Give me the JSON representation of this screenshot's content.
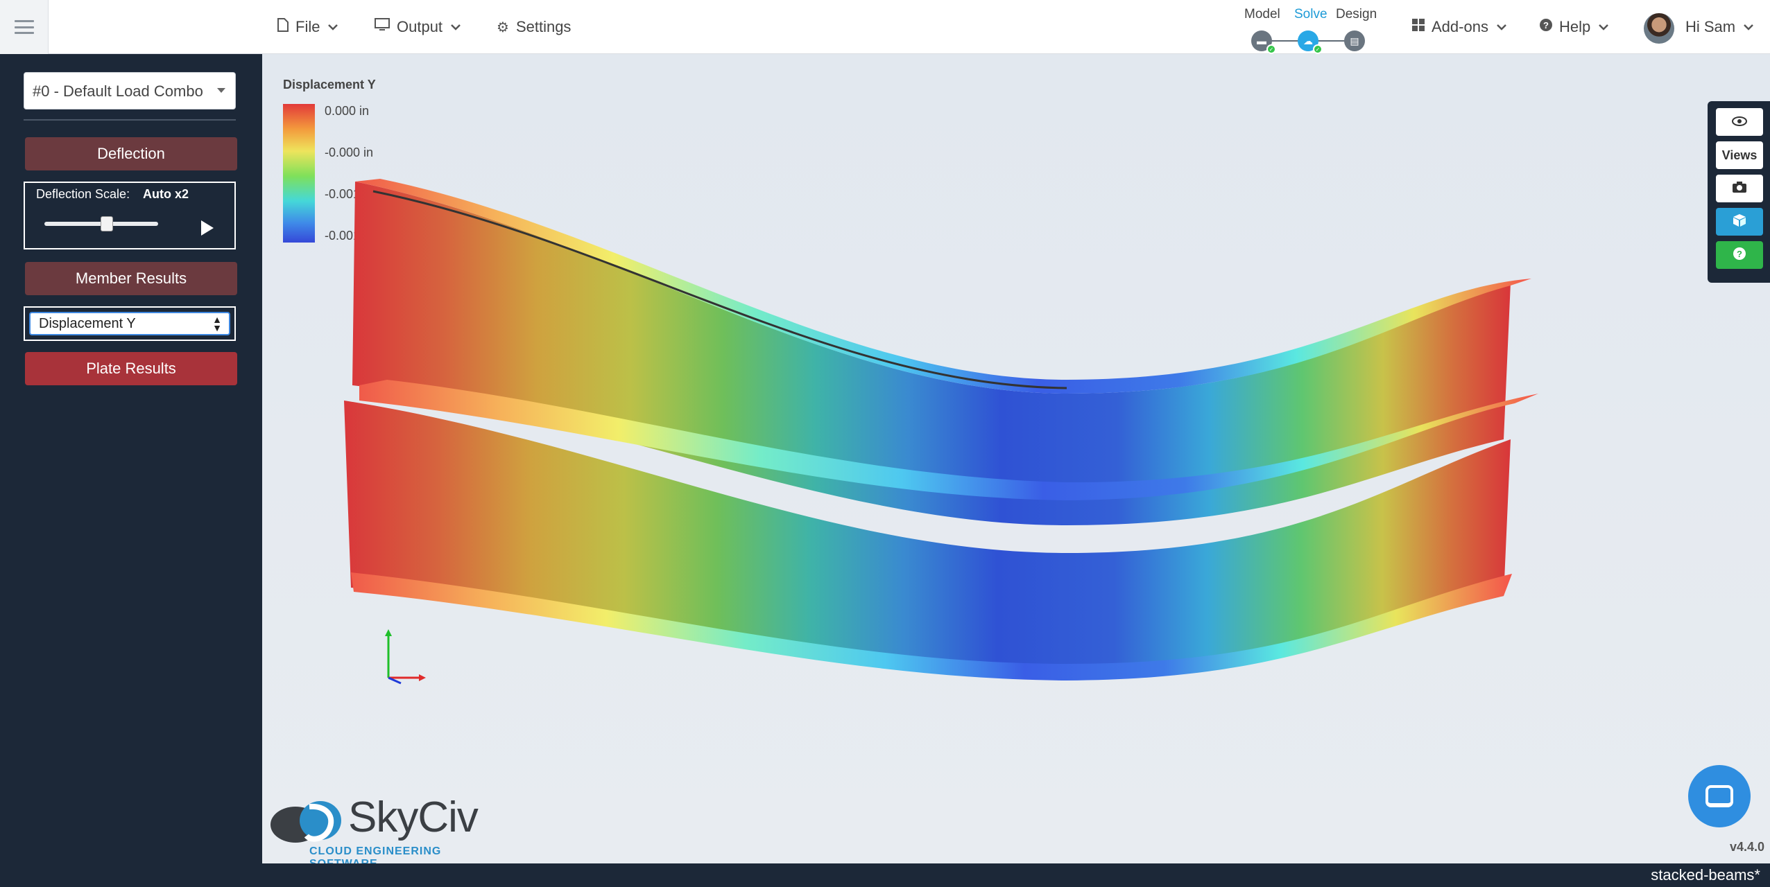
{
  "topbar": {
    "menu": [
      {
        "label": "File",
        "icon": "file-icon"
      },
      {
        "label": "Output",
        "icon": "monitor-icon"
      },
      {
        "label": "Settings",
        "icon": "gear-icon"
      }
    ],
    "steps": [
      {
        "label": "Model",
        "icon": "beam-icon",
        "checked": true
      },
      {
        "label": "Solve",
        "icon": "cloud-icon",
        "checked": true,
        "active": true
      },
      {
        "label": "Design",
        "icon": "document-icon",
        "checked": false
      }
    ],
    "addons_label": "Add-ons",
    "help_label": "Help",
    "user_greeting": "Hi Sam"
  },
  "sidebar": {
    "load_combo": "#0 - Default Load Combo",
    "deflection_button": "Deflection",
    "deflection_scale_label": "Deflection Scale:",
    "deflection_scale_value": "Auto x2",
    "deflection_slider_fraction": 0.55,
    "member_results_button": "Member Results",
    "result_type_selected": "Displacement Y",
    "plate_results_button": "Plate Results"
  },
  "viewport": {
    "legend": {
      "title": "Displacement Y",
      "ticks": [
        "0.000 in",
        "-0.000 in",
        "-0.001 in",
        "-0.001 in"
      ],
      "gradient_colors": [
        "#e23a3a",
        "#f39a3c",
        "#eee45c",
        "#7fe05a",
        "#45d8d8",
        "#3f8ae8",
        "#3548d8"
      ]
    },
    "tools": [
      {
        "name": "eye-icon",
        "label": ""
      },
      {
        "name": "views",
        "label": "Views"
      },
      {
        "name": "camera-icon",
        "label": ""
      },
      {
        "name": "cube-icon",
        "label": ""
      },
      {
        "name": "question-icon",
        "label": ""
      }
    ],
    "version": "v4.4.0",
    "logo_text": "SkyCiv",
    "logo_subtitle": "CLOUD ENGINEERING SOFTWARE"
  },
  "statusbar": {
    "filename": "stacked-beams*"
  },
  "colors": {
    "sidebar_bg": "#1c2838",
    "button_dark": "#6b3a3f",
    "button_red": "#a8333a",
    "accent_blue": "#1e9bd7"
  }
}
